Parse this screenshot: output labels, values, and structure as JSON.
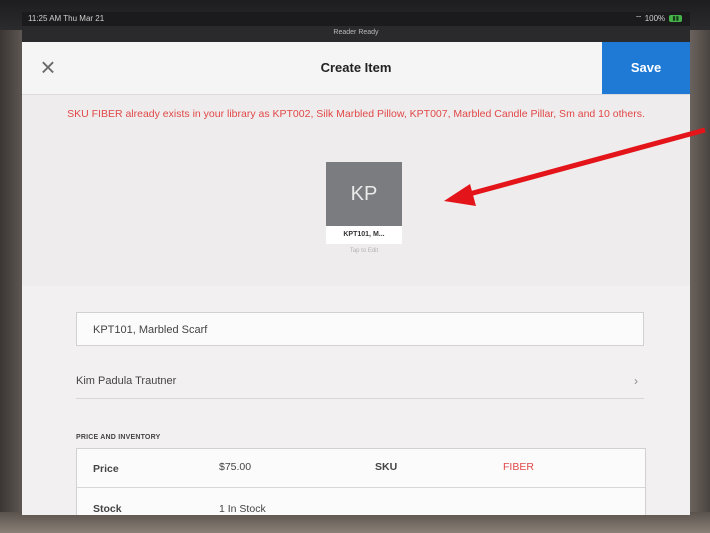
{
  "status": {
    "time": "11:25 AM  Thu Mar 21",
    "battery": "100%",
    "reader": "Reader Ready"
  },
  "header": {
    "title": "Create Item",
    "save_label": "Save",
    "close_symbol": "×"
  },
  "error_message": "SKU FIBER already exists in your library as KPT002, Silk Marbled Pillow, KPT007, Marbled Candle Pillar, Sm and 10 others.",
  "tile": {
    "initials": "KP",
    "label": "KPT101, M...",
    "edit_hint": "Tap to Edit"
  },
  "form": {
    "name_value": "KPT101, Marbled Scarf",
    "vendor": "Kim Padula Trautner",
    "section_label": "PRICE AND INVENTORY",
    "price_label": "Price",
    "price_value": "$75.00",
    "sku_label": "SKU",
    "sku_value": "FIBER",
    "stock_label": "Stock",
    "stock_value": "1 In Stock"
  },
  "colors": {
    "accent": "#1f7ad6",
    "error": "#e24848",
    "annotation_arrow": "#e4151a"
  },
  "icons": {
    "close": "close-icon",
    "chevron": "chevron-right-icon",
    "wifi": "wifi-icon"
  }
}
